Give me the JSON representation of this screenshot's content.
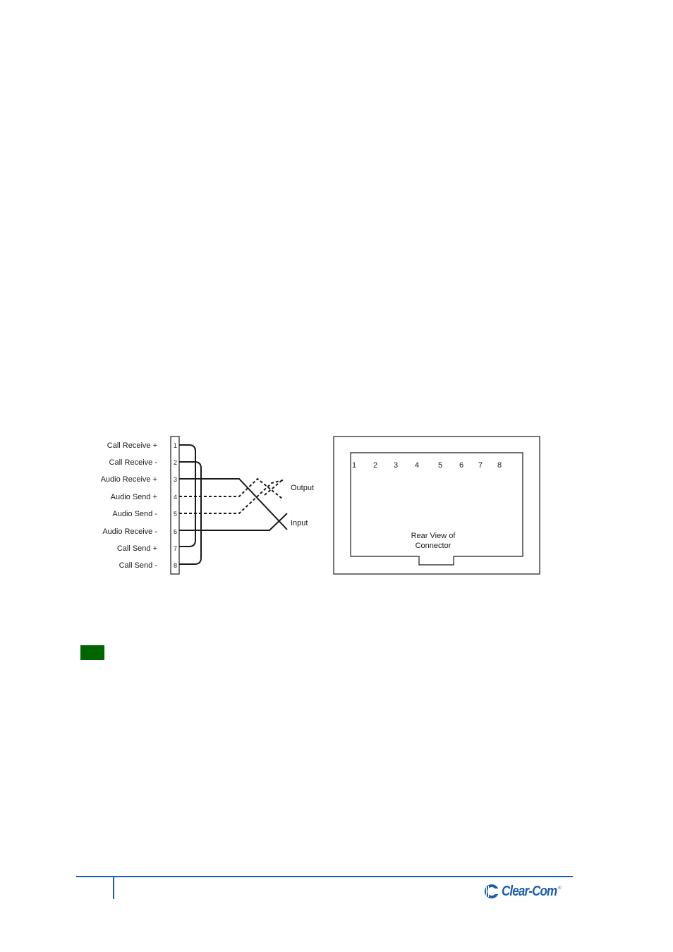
{
  "diagram": {
    "pin_labels": [
      {
        "pin": "1",
        "label": "Call Receive +"
      },
      {
        "pin": "2",
        "label": "Call Receive -"
      },
      {
        "pin": "3",
        "label": "Audio Receive +"
      },
      {
        "pin": "4",
        "label": "Audio Send +"
      },
      {
        "pin": "5",
        "label": "Audio Send -"
      },
      {
        "pin": "6",
        "label": "Audio Receive -"
      },
      {
        "pin": "7",
        "label": "Call Send +"
      },
      {
        "pin": "8",
        "label": "Call Send -"
      }
    ],
    "loops": [
      {
        "from": "1",
        "to": "7"
      },
      {
        "from": "2",
        "to": "8"
      }
    ],
    "signals": {
      "output_label": "Output",
      "input_label": "Input",
      "output_pins": [
        "4",
        "5"
      ],
      "input_pins": [
        "3",
        "6"
      ]
    },
    "rear_view": {
      "pins": [
        "1",
        "2",
        "3",
        "4",
        "5",
        "6",
        "7",
        "8"
      ],
      "caption_line1": "Rear View of",
      "caption_line2": "Connector"
    }
  },
  "colors": {
    "note_block": "#006600",
    "footer_rule": "#1a5fa8",
    "brand": "#1a5fa8"
  },
  "footer": {
    "brand_name": "Clear-Com",
    "registered_mark": "®"
  }
}
